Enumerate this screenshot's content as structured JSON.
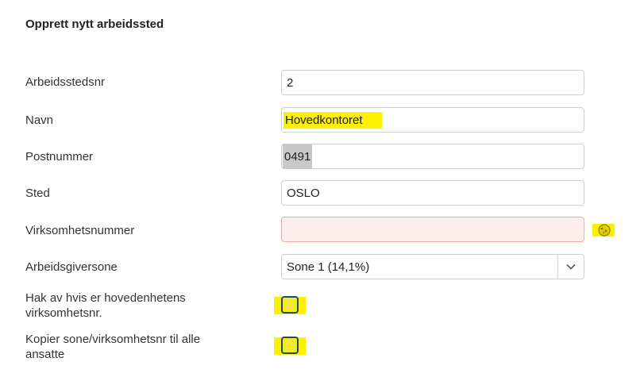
{
  "form": {
    "title": "Opprett nytt arbeidssted",
    "fields": {
      "arbeidsstedsnr": {
        "label": "Arbeidsstedsnr",
        "value": "2"
      },
      "navn": {
        "label": "Navn",
        "value": "Hovedkontoret"
      },
      "postnummer": {
        "label": "Postnummer",
        "value": "0491"
      },
      "sted": {
        "label": "Sted",
        "value": "OSLO"
      },
      "virksomhetsnummer": {
        "label": "Virksomhetsnummer",
        "value": ""
      },
      "arbeidsgiversone": {
        "label": "Arbeidsgiversone",
        "value": "Sone 1 (14,1%)"
      }
    },
    "checkboxes": {
      "hovedenhet": {
        "label": "Hak av hvis er hovedenhetens virksomhetsnr.",
        "checked": false
      },
      "kopier": {
        "label": "Kopier sone/virksomhetsnr til alle ansatte",
        "checked": false
      }
    },
    "icons": {
      "warning": "alert-circle-icon",
      "dropdown": "chevron-down-icon"
    },
    "colors": {
      "highlight": "#ffef00",
      "error_bg": "#fdeeee",
      "error_border": "#f2a9a9",
      "checkbox_border": "#1d4f5c"
    }
  }
}
